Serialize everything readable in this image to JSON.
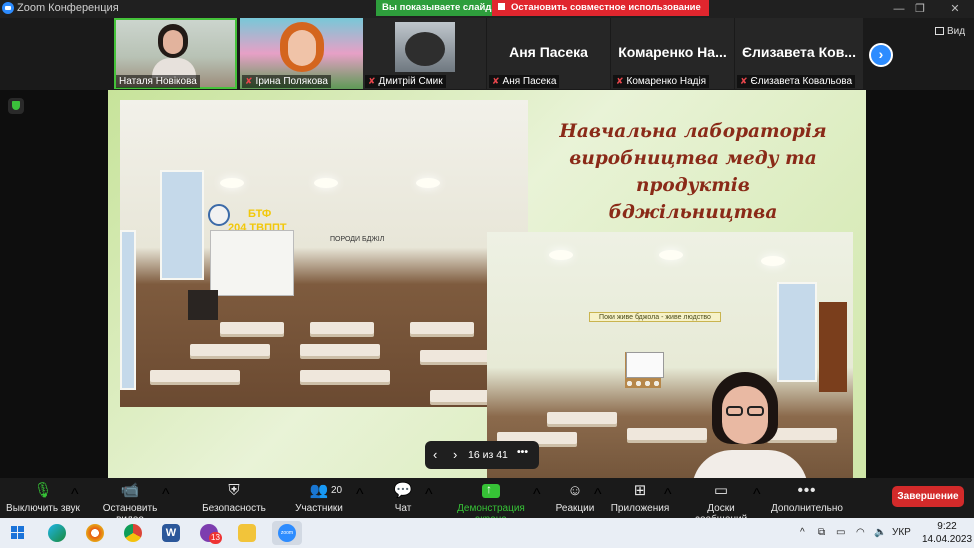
{
  "window": {
    "title": "Zoom Конференция",
    "share_banner": "Вы показываете слайды",
    "stop_share": "Остановить совместное использование",
    "view_label": "Вид"
  },
  "participants": [
    {
      "name": "Натaля Новікова",
      "display": "",
      "muted": false,
      "active": true
    },
    {
      "name": "Ірина Полякова",
      "display": "",
      "muted": true,
      "active": false
    },
    {
      "name": "Дмитрій Смик",
      "display": "",
      "muted": true,
      "active": false
    },
    {
      "name": "Аня Пасека",
      "display": "Аня Пасека",
      "muted": true,
      "active": false
    },
    {
      "name": "Комаренко Надія",
      "display": "Комаренко  На...",
      "muted": true,
      "active": false
    },
    {
      "name": "Єлизавета Ковальова",
      "display": "Єлизавета  Ков...",
      "muted": true,
      "active": false
    }
  ],
  "slide": {
    "title_lines": [
      "Навчальна лабораторія",
      "виробництва меду та продуктів",
      "бджільництва"
    ],
    "photo1_sign_top": "БТФ",
    "photo1_sign_room": "204 ТВППТ",
    "photo1_board": "ПОРОДИ БДЖІЛ",
    "photo2_banner": "Поки живе бджола - живе людство",
    "page": "16 из 41"
  },
  "toolbar": {
    "mute": "Выключить звук",
    "video": "Остановить видео",
    "security": "Безопасность",
    "participants": "Участники",
    "participants_count": "20",
    "chat": "Чат",
    "share": "Демонстрация экрана",
    "reactions": "Реакции",
    "apps": "Приложения",
    "whiteboards": "Доски сообщений",
    "more": "Дополнительно",
    "end": "Завершение"
  },
  "taskbar": {
    "language": "УКР",
    "time": "9:22",
    "date": "14.04.2023",
    "viber_badge": "13"
  }
}
